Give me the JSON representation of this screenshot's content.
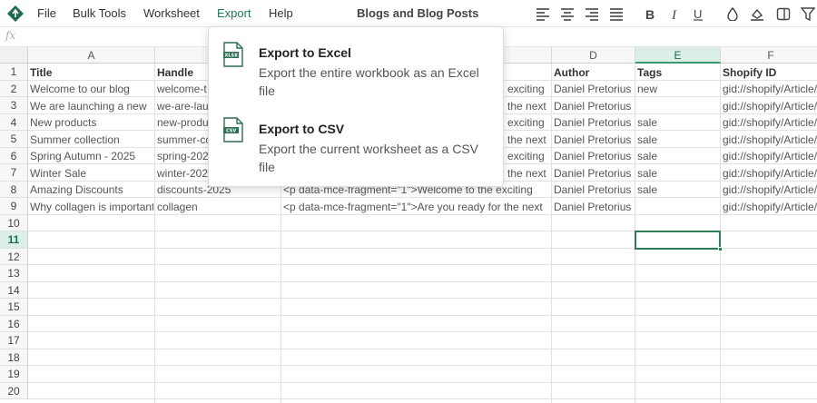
{
  "menu": {
    "file": "File",
    "bulk_tools": "Bulk Tools",
    "worksheet": "Worksheet",
    "export": "Export",
    "help": "Help"
  },
  "document_title": "Blogs and Blog Posts",
  "toolbar_icons": [
    "align-left-icon",
    "align-center-icon",
    "align-right-icon",
    "align-justify-icon",
    "bold-icon",
    "italic-icon",
    "underline-icon",
    "fill-color-icon",
    "text-color-icon",
    "freeze-columns-icon",
    "filter-icon"
  ],
  "formula_bar": {
    "fx": "fx",
    "value": ""
  },
  "grid": {
    "columns": [
      "A",
      "B",
      "C",
      "D",
      "E",
      "F"
    ],
    "selected_column": "E",
    "rows": [
      "1",
      "2",
      "3",
      "4",
      "5",
      "6",
      "7",
      "8",
      "9",
      "10",
      "11",
      "12",
      "13",
      "14",
      "15",
      "16",
      "17",
      "18",
      "19",
      "20"
    ],
    "selected_row": "11",
    "selected_cell": "E11",
    "header": [
      "Title",
      "Handle",
      "",
      "Author",
      "Tags",
      "Shopify ID"
    ],
    "data": [
      [
        "Welcome to our blog",
        "welcome-t",
        "",
        "Daniel Pretorius",
        "new",
        "gid://shopify/Article/"
      ],
      [
        "We are launching a new",
        "we-are-lau",
        "",
        "Daniel Pretorius",
        "",
        "gid://shopify/Article/"
      ],
      [
        "New products",
        "new-produ",
        "",
        "Daniel Pretorius",
        "sale",
        "gid://shopify/Article/"
      ],
      [
        "Summer collection",
        "summer-co",
        "",
        "Daniel Pretorius",
        "sale",
        "gid://shopify/Article/"
      ],
      [
        "Spring Autumn - 2025",
        "spring-202",
        "",
        "Daniel Pretorius",
        "sale",
        "gid://shopify/Article/"
      ],
      [
        "Winter Sale",
        "winter-202",
        "",
        "Daniel Pretorius",
        "sale",
        "gid://shopify/Article/"
      ],
      [
        "Amazing Discounts",
        "discounts-2025",
        "<p data-mce-fragment=\"1\">Welcome to the exciting",
        "Daniel Pretorius",
        "sale",
        "gid://shopify/Article/"
      ],
      [
        "Why collagen is important",
        "collagen",
        "<p data-mce-fragment=\"1\">Are you ready for the next",
        "Daniel Pretorius",
        "",
        "gid://shopify/Article/"
      ]
    ],
    "c_visible_tails": [
      "exciting",
      "the next",
      "exciting",
      "the next",
      "exciting",
      "the next"
    ]
  },
  "export_menu": {
    "items": [
      {
        "icon_text": "XLSX",
        "title": "Export to Excel",
        "description": "Export the entire workbook as an Excel file"
      },
      {
        "icon_text": "CSV",
        "title": "Export to CSV",
        "description": "Export the current worksheet as a CSV file"
      }
    ]
  },
  "colors": {
    "accent": "#1f7a58",
    "selection": "#2e7d57",
    "header_selected": "#dcefe6"
  }
}
